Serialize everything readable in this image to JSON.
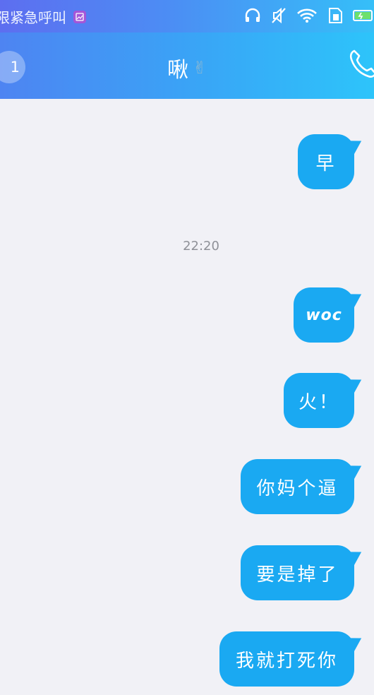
{
  "status_bar": {
    "emergency_text": "限紧急呼叫",
    "icons": [
      "image-icon",
      "headphones-icon",
      "mute-icon",
      "wifi-icon",
      "sim-icon",
      "battery-icon"
    ]
  },
  "header": {
    "back_count": "1",
    "title": "啾",
    "title_emoji": "✌",
    "call_icon": "phone-icon"
  },
  "chat": {
    "timestamp": "22:20",
    "messages": [
      {
        "text": "早",
        "side": "right"
      },
      {
        "text": "woc",
        "side": "right"
      },
      {
        "text": "火！",
        "side": "right"
      },
      {
        "text": "你妈个逼",
        "side": "right"
      },
      {
        "text": "要是掉了",
        "side": "right"
      },
      {
        "text": "我就打死你",
        "side": "right"
      }
    ]
  },
  "colors": {
    "bubble": "#1aa9f2",
    "background": "#f1f1f6",
    "header_start": "#4e84f2",
    "header_end": "#2dc4fa"
  }
}
